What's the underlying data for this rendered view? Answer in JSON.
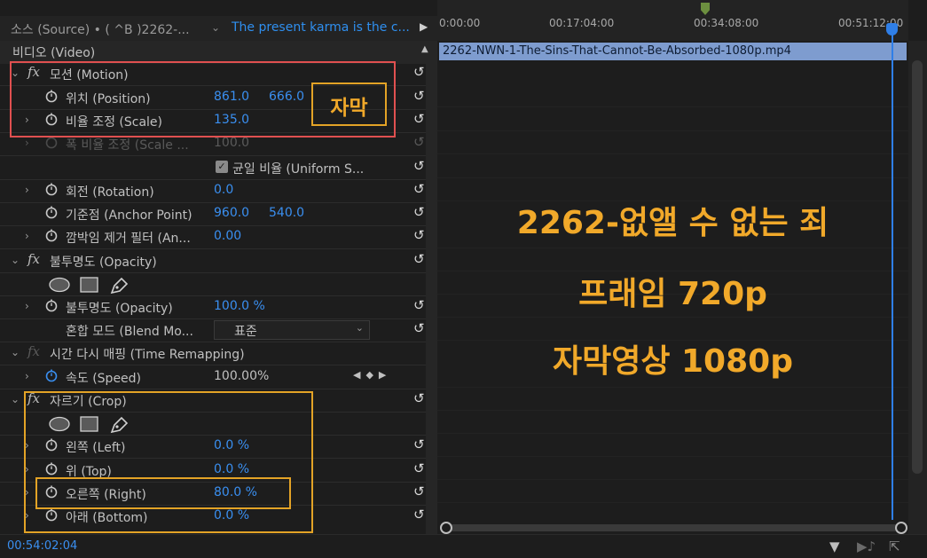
{
  "header": {
    "source_tab": "소스 (Source) • ( ^B )2262-...",
    "clip_tab": "The present karma is the c...",
    "caret": "⌄",
    "play": "▶"
  },
  "effects": {
    "video_header": "비디오 (Video)",
    "motion": {
      "label": "모션 (Motion)",
      "position_label": "위치 (Position)",
      "position_x": "861.0",
      "position_y": "666.0",
      "scale_label": "비율 조정 (Scale)",
      "scale_value": "135.0",
      "scale_width_label": "폭 비율 조정 (Scale ...",
      "scale_width_value": "100.0",
      "uniform_label": "균일 비율 (Uniform S...",
      "rotation_label": "회전 (Rotation)",
      "rotation_value": "0.0",
      "anchor_label": "기준점 (Anchor Point)",
      "anchor_x": "960.0",
      "anchor_y": "540.0",
      "flicker_label": "깜박임 제거 필터 (An...",
      "flicker_value": "0.00"
    },
    "opacity": {
      "label": "불투명도 (Opacity)",
      "opacity_label": "불투명도 (Opacity)",
      "opacity_value": "100.0",
      "unit": "%",
      "blend_label": "혼합 모드 (Blend Mo...",
      "blend_value": "표준"
    },
    "time_remap": {
      "label": "시간 다시 매핑 (Time Remapping)",
      "speed_label": "속도 (Speed)",
      "speed_value": "100.00%"
    },
    "crop": {
      "label": "자르기 (Crop)",
      "left_label": "왼쪽 (Left)",
      "left_value": "0.0",
      "top_label": "위 (Top)",
      "top_value": "0.0",
      "right_label": "오른쪽 (Right)",
      "right_value": "80.0",
      "bottom_label": "아래 (Bottom)",
      "bottom_value": "0.0",
      "unit": "%"
    }
  },
  "annotations": {
    "subtitle_tag": "자막",
    "line1": "2262-없앨 수 없는 죄",
    "line2": "프래임 720p",
    "line3": "자막영상 1080p"
  },
  "timeline": {
    "ticks": [
      "0:00:00",
      "00:17:04:00",
      "00:34:08:00",
      "00:51:12:00"
    ],
    "clip_name": "2262-NWN-1-The-Sins-That-Cannot-Be-Absorbed-1080p.mp4"
  },
  "footer": {
    "timecode": "00:54:02:04"
  },
  "colors": {
    "accent_blue": "#3a8ff0",
    "annotation_orange": "#f1a92a",
    "annotation_red": "#e05050",
    "clip_blue": "#7e9ccf",
    "marker_green": "#6c8f3f"
  },
  "icons": {
    "fx": "fx-icon",
    "stopwatch": "stopwatch-icon",
    "reset": "reset-icon",
    "ellipse": "ellipse-mask-icon",
    "rect": "rectangle-mask-icon",
    "pen": "pen-mask-icon",
    "filter": "filter-icon"
  }
}
